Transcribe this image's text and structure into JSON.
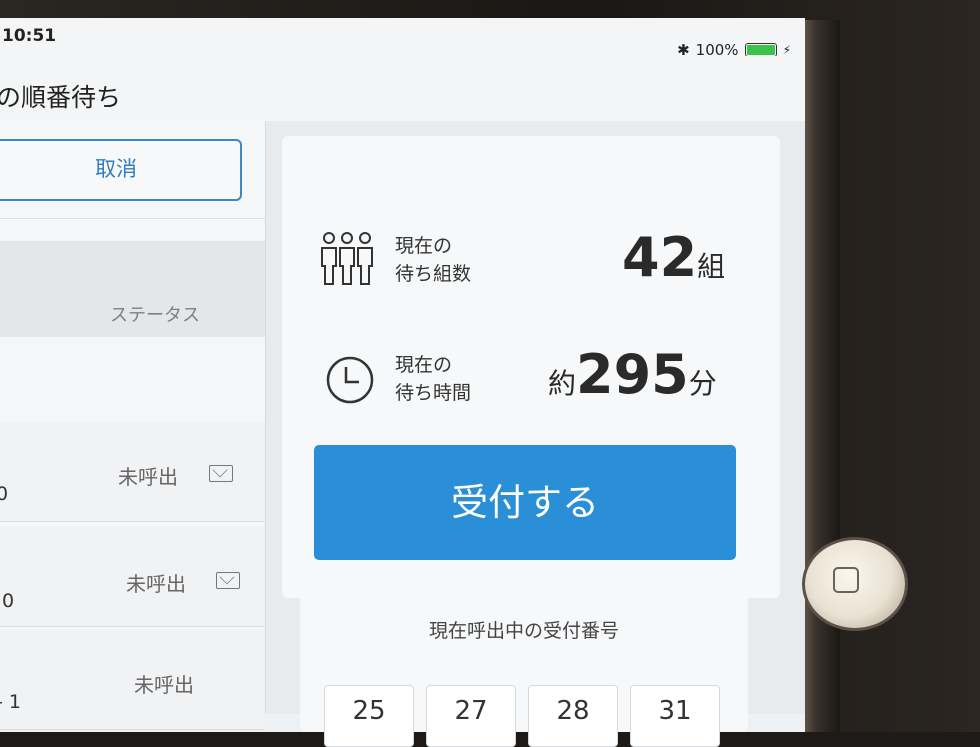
{
  "status_bar": {
    "time": "10:51",
    "bluetooth_icon": "bluetooth-icon",
    "battery": "100%"
  },
  "nav": {
    "title": "の順番待ち"
  },
  "left": {
    "cancel_label": "取消",
    "status_header": "ステータス",
    "rows": [
      {
        "status": "未呼出",
        "number": "0",
        "mail": true
      },
      {
        "status": "未呼出",
        "number": "0",
        "mail": true
      },
      {
        "status": "未呼出",
        "number": "- 1",
        "mail": false
      }
    ]
  },
  "stats": {
    "groups_label_1": "現在の",
    "groups_label_2": "待ち組数",
    "groups_value": "42",
    "groups_unit": "組",
    "time_label_1": "現在の",
    "time_label_2": "待ち時間",
    "time_prefix": "約",
    "time_value": "295",
    "time_unit": "分"
  },
  "accept_button": "受付する",
  "calling": {
    "title": "現在呼出中の受付番号",
    "numbers": [
      "25",
      "27",
      "28",
      "31"
    ]
  },
  "colors": {
    "accent": "#2a8fd6",
    "cancel_border": "#3d87c6"
  }
}
